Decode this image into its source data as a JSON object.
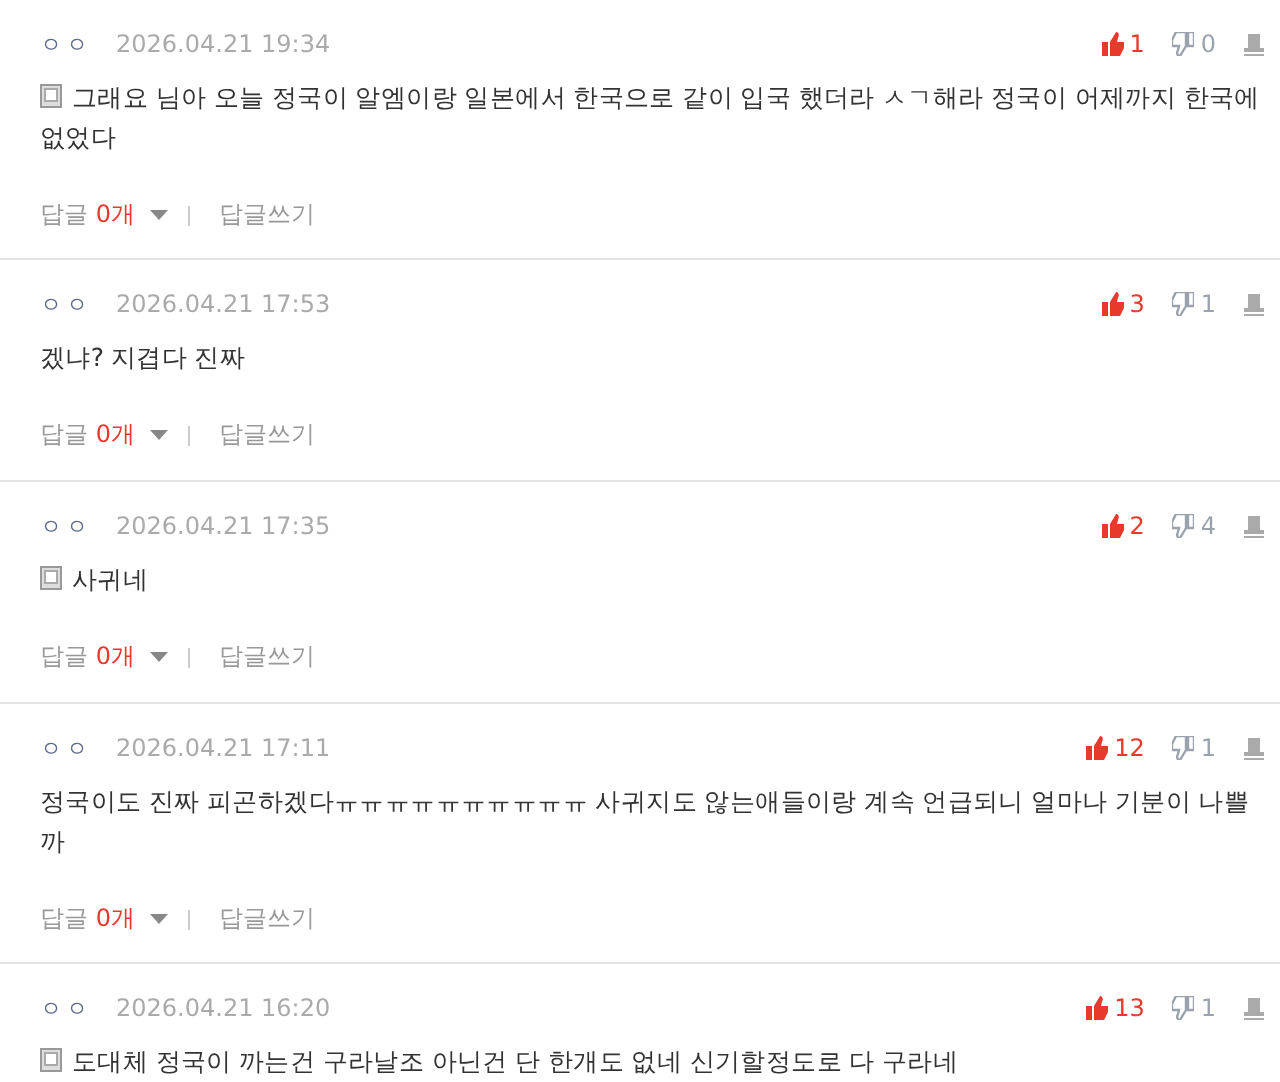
{
  "comments": [
    {
      "author": "ㅇㅇ",
      "date": "2026.04.21 19:34",
      "note": true,
      "text": "그래요 님아 오늘 정국이 알엠이랑 일본에서 한국으로 같이 입국 했더라 ㅅㄱ해라 정국이 어제까지 한국에 없었다",
      "likes": "1",
      "dislikes": "0",
      "reply_label": "답글",
      "reply_count": "0개",
      "write_label": "답글쓰기"
    },
    {
      "author": "ㅇㅇ",
      "date": "2026.04.21 17:53",
      "note": false,
      "text": "겠냐? 지겹다 진짜",
      "likes": "3",
      "dislikes": "1",
      "reply_label": "답글",
      "reply_count": "0개",
      "write_label": "답글쓰기"
    },
    {
      "author": "ㅇㅇ",
      "date": "2026.04.21 17:35",
      "note": true,
      "text": "사귀네",
      "likes": "2",
      "dislikes": "4",
      "reply_label": "답글",
      "reply_count": "0개",
      "write_label": "답글쓰기"
    },
    {
      "author": "ㅇㅇ",
      "date": "2026.04.21 17:11",
      "note": false,
      "text": "정국이도 진짜 피곤하겠다ㅠㅠㅠㅠㅠㅠㅠㅠㅠㅠ 사귀지도 않는애들이랑 계속 언급되니 얼마나 기분이 나쁠까",
      "likes": "12",
      "dislikes": "1",
      "reply_label": "답글",
      "reply_count": "0개",
      "write_label": "답글쓰기"
    },
    {
      "author": "ㅇㅇ",
      "date": "2026.04.21 16:20",
      "note": true,
      "text": "도대체 정국이 까는건 구라날조 아닌건 단 한개도 없네 신기할정도로 다 구라네",
      "likes": "13",
      "dislikes": "1"
    }
  ]
}
